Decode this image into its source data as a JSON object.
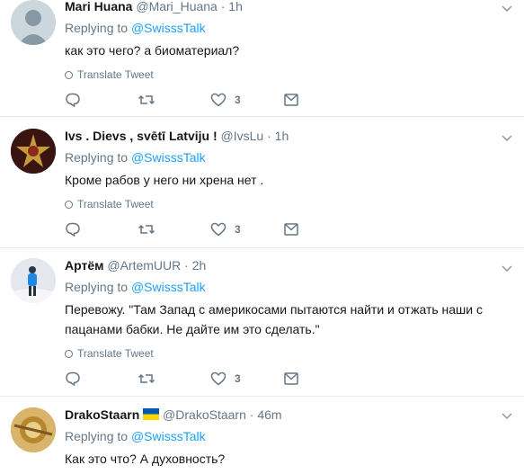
{
  "tweets": [
    {
      "fullname": "Mari Huana",
      "username": "@Mari_Huana",
      "dot": "·",
      "time": "1h",
      "reply_prefix": "Replying to",
      "reply_handle": "@SwisssTalk",
      "text": "как это чего? а биоматериал?",
      "translate": "Translate Tweet",
      "likes": "3",
      "flag": ""
    },
    {
      "fullname": "Ivs . Dievs , svētī Latviju !",
      "username": "@IvsLu",
      "dot": "·",
      "time": "1h",
      "reply_prefix": "Replying to",
      "reply_handle": "@SwisssTalk",
      "text": "Кроме рабов у него ни хрена нет .",
      "translate": "Translate Tweet",
      "likes": "3",
      "flag": ""
    },
    {
      "fullname": "Артём",
      "username": "@ArtemUUR",
      "dot": "·",
      "time": "2h",
      "reply_prefix": "Replying to",
      "reply_handle": "@SwisssTalk",
      "text": "Перевожу. \"Там Запад с америкосами пытаются найти и отжать наши с пацанами бабки. Не дайте им это сделать.\"",
      "translate": "Translate Tweet",
      "likes": "3",
      "flag": ""
    },
    {
      "fullname": "DrakoStaarn",
      "username": "@DrakoStaarn",
      "dot": "·",
      "time": "46m",
      "reply_prefix": "Replying to",
      "reply_handle": "@SwisssTalk",
      "text": "Как это что? А духовность?",
      "flag": "ukraine-flag"
    }
  ],
  "colors": {
    "link": "#1da1f2",
    "muted": "#657786",
    "divider": "#e6ecf0",
    "flag_blue": "#0057b7",
    "flag_yellow": "#ffd700"
  },
  "icons": [
    "globe-icon",
    "reply-icon",
    "retweet-icon",
    "heart-icon",
    "mail-icon",
    "chevron-down-icon"
  ]
}
